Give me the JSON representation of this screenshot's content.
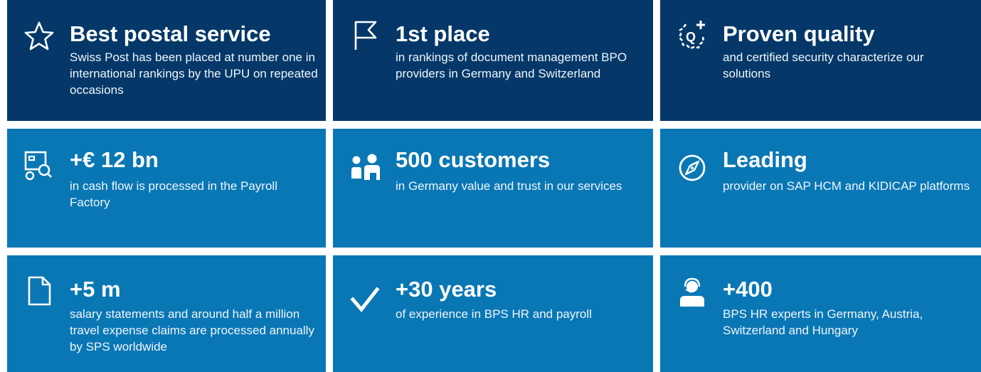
{
  "tiles": [
    {
      "title": "Best postal service",
      "desc": "Swiss Post has been placed at number one in international rankings by the UPU on repeated occasions",
      "icon": "star-icon"
    },
    {
      "title": "1st place",
      "desc": "in rankings of document management BPO providers in Germany and Switzerland",
      "icon": "flag-icon"
    },
    {
      "title": "Proven quality",
      "desc": "and certified security characterize our solutions",
      "icon": "quality-seal-icon"
    },
    {
      "title": "+€ 12 bn",
      "desc": "in cash flow is processed in the Payroll Factory",
      "icon": "cash-flow-icon"
    },
    {
      "title": "500 customers",
      "desc": "in Germany value and trust in our services",
      "icon": "people-icon"
    },
    {
      "title": "Leading",
      "desc": "provider on SAP HCM and KIDICAP platforms",
      "icon": "compass-icon"
    },
    {
      "title": "+5 m",
      "desc": "salary statements and around half a million travel expense claims are processed annually by SPS worldwide",
      "icon": "document-icon"
    },
    {
      "title": "+30 years",
      "desc": "of experience in BPS HR and payroll",
      "icon": "checkmark-icon"
    },
    {
      "title": "+400",
      "desc": "BPS HR experts in Germany, Austria, Switzerland and Hungary",
      "icon": "headset-person-icon"
    }
  ],
  "colors": {
    "row1": "#053868",
    "rows2_3": "#0a77b5"
  }
}
